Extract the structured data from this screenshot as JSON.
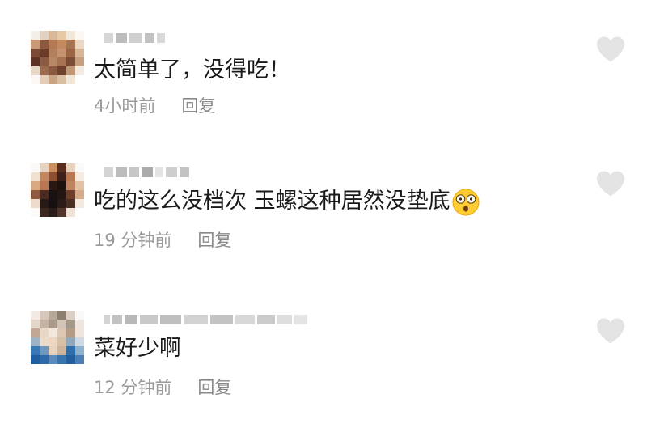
{
  "comments": [
    {
      "text": "太简单了，没得吃！",
      "time": "4小时前",
      "reply_label": "回复"
    },
    {
      "text": "吃的这么没档次 玉螺这种居然没垫底",
      "time": "19 分钟前",
      "reply_label": "回复",
      "emoji": "astonished-face"
    },
    {
      "text": "菜好少啊",
      "time": "12 分钟前",
      "reply_label": "回复"
    }
  ],
  "colors": {
    "text": "#1a1a1a",
    "meta": "#9a9a9a",
    "like_icon": "#e4e4e4"
  },
  "icons": {
    "like": "heart-icon"
  }
}
